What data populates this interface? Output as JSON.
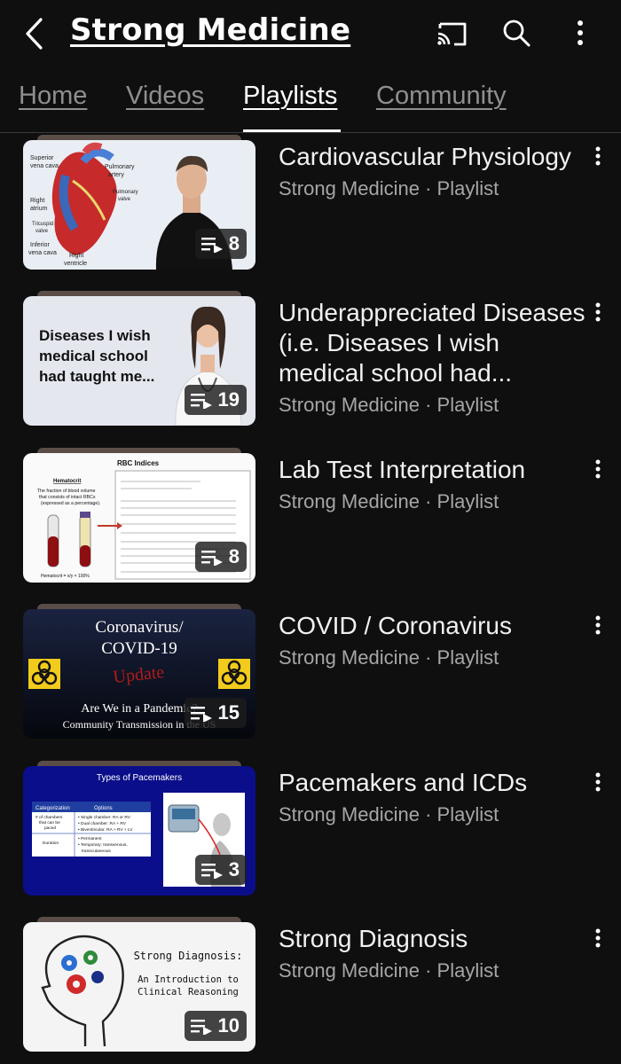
{
  "header": {
    "title": "Strong Medicine",
    "icons": [
      "back-arrow-icon",
      "cast-icon",
      "search-icon",
      "more-vert-icon"
    ]
  },
  "tabs": [
    {
      "label": "Home",
      "active": false
    },
    {
      "label": "Videos",
      "active": false
    },
    {
      "label": "Playlists",
      "active": true
    },
    {
      "label": "Community",
      "active": false
    }
  ],
  "playlists": [
    {
      "title": "Cardiovascular Physiology",
      "subtitle": "Strong Medicine · Playlist",
      "count": "8",
      "thumb_text": [
        "Superior",
        "vena cava",
        "Pulmonary",
        "artery",
        "Pulmonary",
        "valve",
        "Right",
        "atrium",
        "Tricuspid",
        "valve",
        "Inferior",
        "vena cava",
        "Right",
        "ventricle"
      ]
    },
    {
      "title": "Underappreciated Diseases (i.e. Diseases I wish medical school had...",
      "subtitle": "Strong Medicine · Playlist",
      "count": "19",
      "thumb_text": [
        "Diseases I wish",
        "medical school",
        "had taught me..."
      ]
    },
    {
      "title": "Lab Test Interpretation",
      "subtitle": "Strong Medicine · Playlist",
      "count": "8",
      "thumb_text": [
        "RBC Indices",
        "Hematocrit",
        "The fraction of blood volume",
        "that consists of intact RBCs",
        "(expressed as a percentage).",
        "Hematocrit = x/y × 100%"
      ]
    },
    {
      "title": "COVID / Coronavirus",
      "subtitle": "Strong Medicine · Playlist",
      "count": "15",
      "thumb_text": [
        "Coronavirus/",
        "COVID-19",
        "Update",
        "Are We in a Pandemic?",
        "Community Transmission in the US"
      ]
    },
    {
      "title": "Pacemakers and ICDs",
      "subtitle": "Strong Medicine · Playlist",
      "count": "3",
      "thumb_text": [
        "Types of Pacemakers",
        "Categorization",
        "Options",
        "# of chambers",
        "that can be",
        "paced",
        "• Single chamber: RA or RV",
        "• Dual chamber: RA + RV",
        "• Biventricular: RA + RV + LV",
        "Duration",
        "• Permanent",
        "• Temporary: transvenous,",
        "transcutaneous"
      ]
    },
    {
      "title": "Strong Diagnosis",
      "subtitle": "Strong Medicine · Playlist",
      "count": "10",
      "thumb_text": [
        "Strong Diagnosis:",
        "An Introduction to",
        "Clinical Reasoning"
      ]
    }
  ]
}
